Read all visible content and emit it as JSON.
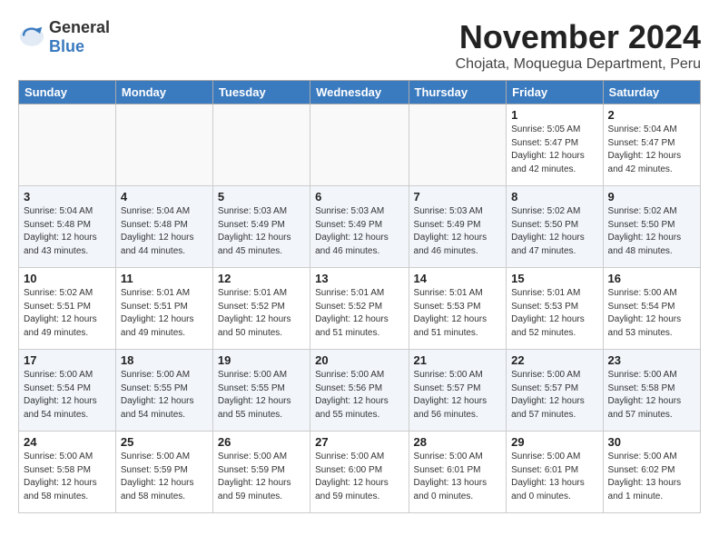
{
  "logo": {
    "general": "General",
    "blue": "Blue"
  },
  "title": {
    "month_year": "November 2024",
    "location": "Chojata, Moquegua Department, Peru"
  },
  "weekdays": [
    "Sunday",
    "Monday",
    "Tuesday",
    "Wednesday",
    "Thursday",
    "Friday",
    "Saturday"
  ],
  "weeks": [
    [
      {
        "day": "",
        "info": ""
      },
      {
        "day": "",
        "info": ""
      },
      {
        "day": "",
        "info": ""
      },
      {
        "day": "",
        "info": ""
      },
      {
        "day": "",
        "info": ""
      },
      {
        "day": "1",
        "info": "Sunrise: 5:05 AM\nSunset: 5:47 PM\nDaylight: 12 hours\nand 42 minutes."
      },
      {
        "day": "2",
        "info": "Sunrise: 5:04 AM\nSunset: 5:47 PM\nDaylight: 12 hours\nand 42 minutes."
      }
    ],
    [
      {
        "day": "3",
        "info": "Sunrise: 5:04 AM\nSunset: 5:48 PM\nDaylight: 12 hours\nand 43 minutes."
      },
      {
        "day": "4",
        "info": "Sunrise: 5:04 AM\nSunset: 5:48 PM\nDaylight: 12 hours\nand 44 minutes."
      },
      {
        "day": "5",
        "info": "Sunrise: 5:03 AM\nSunset: 5:49 PM\nDaylight: 12 hours\nand 45 minutes."
      },
      {
        "day": "6",
        "info": "Sunrise: 5:03 AM\nSunset: 5:49 PM\nDaylight: 12 hours\nand 46 minutes."
      },
      {
        "day": "7",
        "info": "Sunrise: 5:03 AM\nSunset: 5:49 PM\nDaylight: 12 hours\nand 46 minutes."
      },
      {
        "day": "8",
        "info": "Sunrise: 5:02 AM\nSunset: 5:50 PM\nDaylight: 12 hours\nand 47 minutes."
      },
      {
        "day": "9",
        "info": "Sunrise: 5:02 AM\nSunset: 5:50 PM\nDaylight: 12 hours\nand 48 minutes."
      }
    ],
    [
      {
        "day": "10",
        "info": "Sunrise: 5:02 AM\nSunset: 5:51 PM\nDaylight: 12 hours\nand 49 minutes."
      },
      {
        "day": "11",
        "info": "Sunrise: 5:01 AM\nSunset: 5:51 PM\nDaylight: 12 hours\nand 49 minutes."
      },
      {
        "day": "12",
        "info": "Sunrise: 5:01 AM\nSunset: 5:52 PM\nDaylight: 12 hours\nand 50 minutes."
      },
      {
        "day": "13",
        "info": "Sunrise: 5:01 AM\nSunset: 5:52 PM\nDaylight: 12 hours\nand 51 minutes."
      },
      {
        "day": "14",
        "info": "Sunrise: 5:01 AM\nSunset: 5:53 PM\nDaylight: 12 hours\nand 51 minutes."
      },
      {
        "day": "15",
        "info": "Sunrise: 5:01 AM\nSunset: 5:53 PM\nDaylight: 12 hours\nand 52 minutes."
      },
      {
        "day": "16",
        "info": "Sunrise: 5:00 AM\nSunset: 5:54 PM\nDaylight: 12 hours\nand 53 minutes."
      }
    ],
    [
      {
        "day": "17",
        "info": "Sunrise: 5:00 AM\nSunset: 5:54 PM\nDaylight: 12 hours\nand 54 minutes."
      },
      {
        "day": "18",
        "info": "Sunrise: 5:00 AM\nSunset: 5:55 PM\nDaylight: 12 hours\nand 54 minutes."
      },
      {
        "day": "19",
        "info": "Sunrise: 5:00 AM\nSunset: 5:55 PM\nDaylight: 12 hours\nand 55 minutes."
      },
      {
        "day": "20",
        "info": "Sunrise: 5:00 AM\nSunset: 5:56 PM\nDaylight: 12 hours\nand 55 minutes."
      },
      {
        "day": "21",
        "info": "Sunrise: 5:00 AM\nSunset: 5:57 PM\nDaylight: 12 hours\nand 56 minutes."
      },
      {
        "day": "22",
        "info": "Sunrise: 5:00 AM\nSunset: 5:57 PM\nDaylight: 12 hours\nand 57 minutes."
      },
      {
        "day": "23",
        "info": "Sunrise: 5:00 AM\nSunset: 5:58 PM\nDaylight: 12 hours\nand 57 minutes."
      }
    ],
    [
      {
        "day": "24",
        "info": "Sunrise: 5:00 AM\nSunset: 5:58 PM\nDaylight: 12 hours\nand 58 minutes."
      },
      {
        "day": "25",
        "info": "Sunrise: 5:00 AM\nSunset: 5:59 PM\nDaylight: 12 hours\nand 58 minutes."
      },
      {
        "day": "26",
        "info": "Sunrise: 5:00 AM\nSunset: 5:59 PM\nDaylight: 12 hours\nand 59 minutes."
      },
      {
        "day": "27",
        "info": "Sunrise: 5:00 AM\nSunset: 6:00 PM\nDaylight: 12 hours\nand 59 minutes."
      },
      {
        "day": "28",
        "info": "Sunrise: 5:00 AM\nSunset: 6:01 PM\nDaylight: 13 hours\nand 0 minutes."
      },
      {
        "day": "29",
        "info": "Sunrise: 5:00 AM\nSunset: 6:01 PM\nDaylight: 13 hours\nand 0 minutes."
      },
      {
        "day": "30",
        "info": "Sunrise: 5:00 AM\nSunset: 6:02 PM\nDaylight: 13 hours\nand 1 minute."
      }
    ]
  ]
}
